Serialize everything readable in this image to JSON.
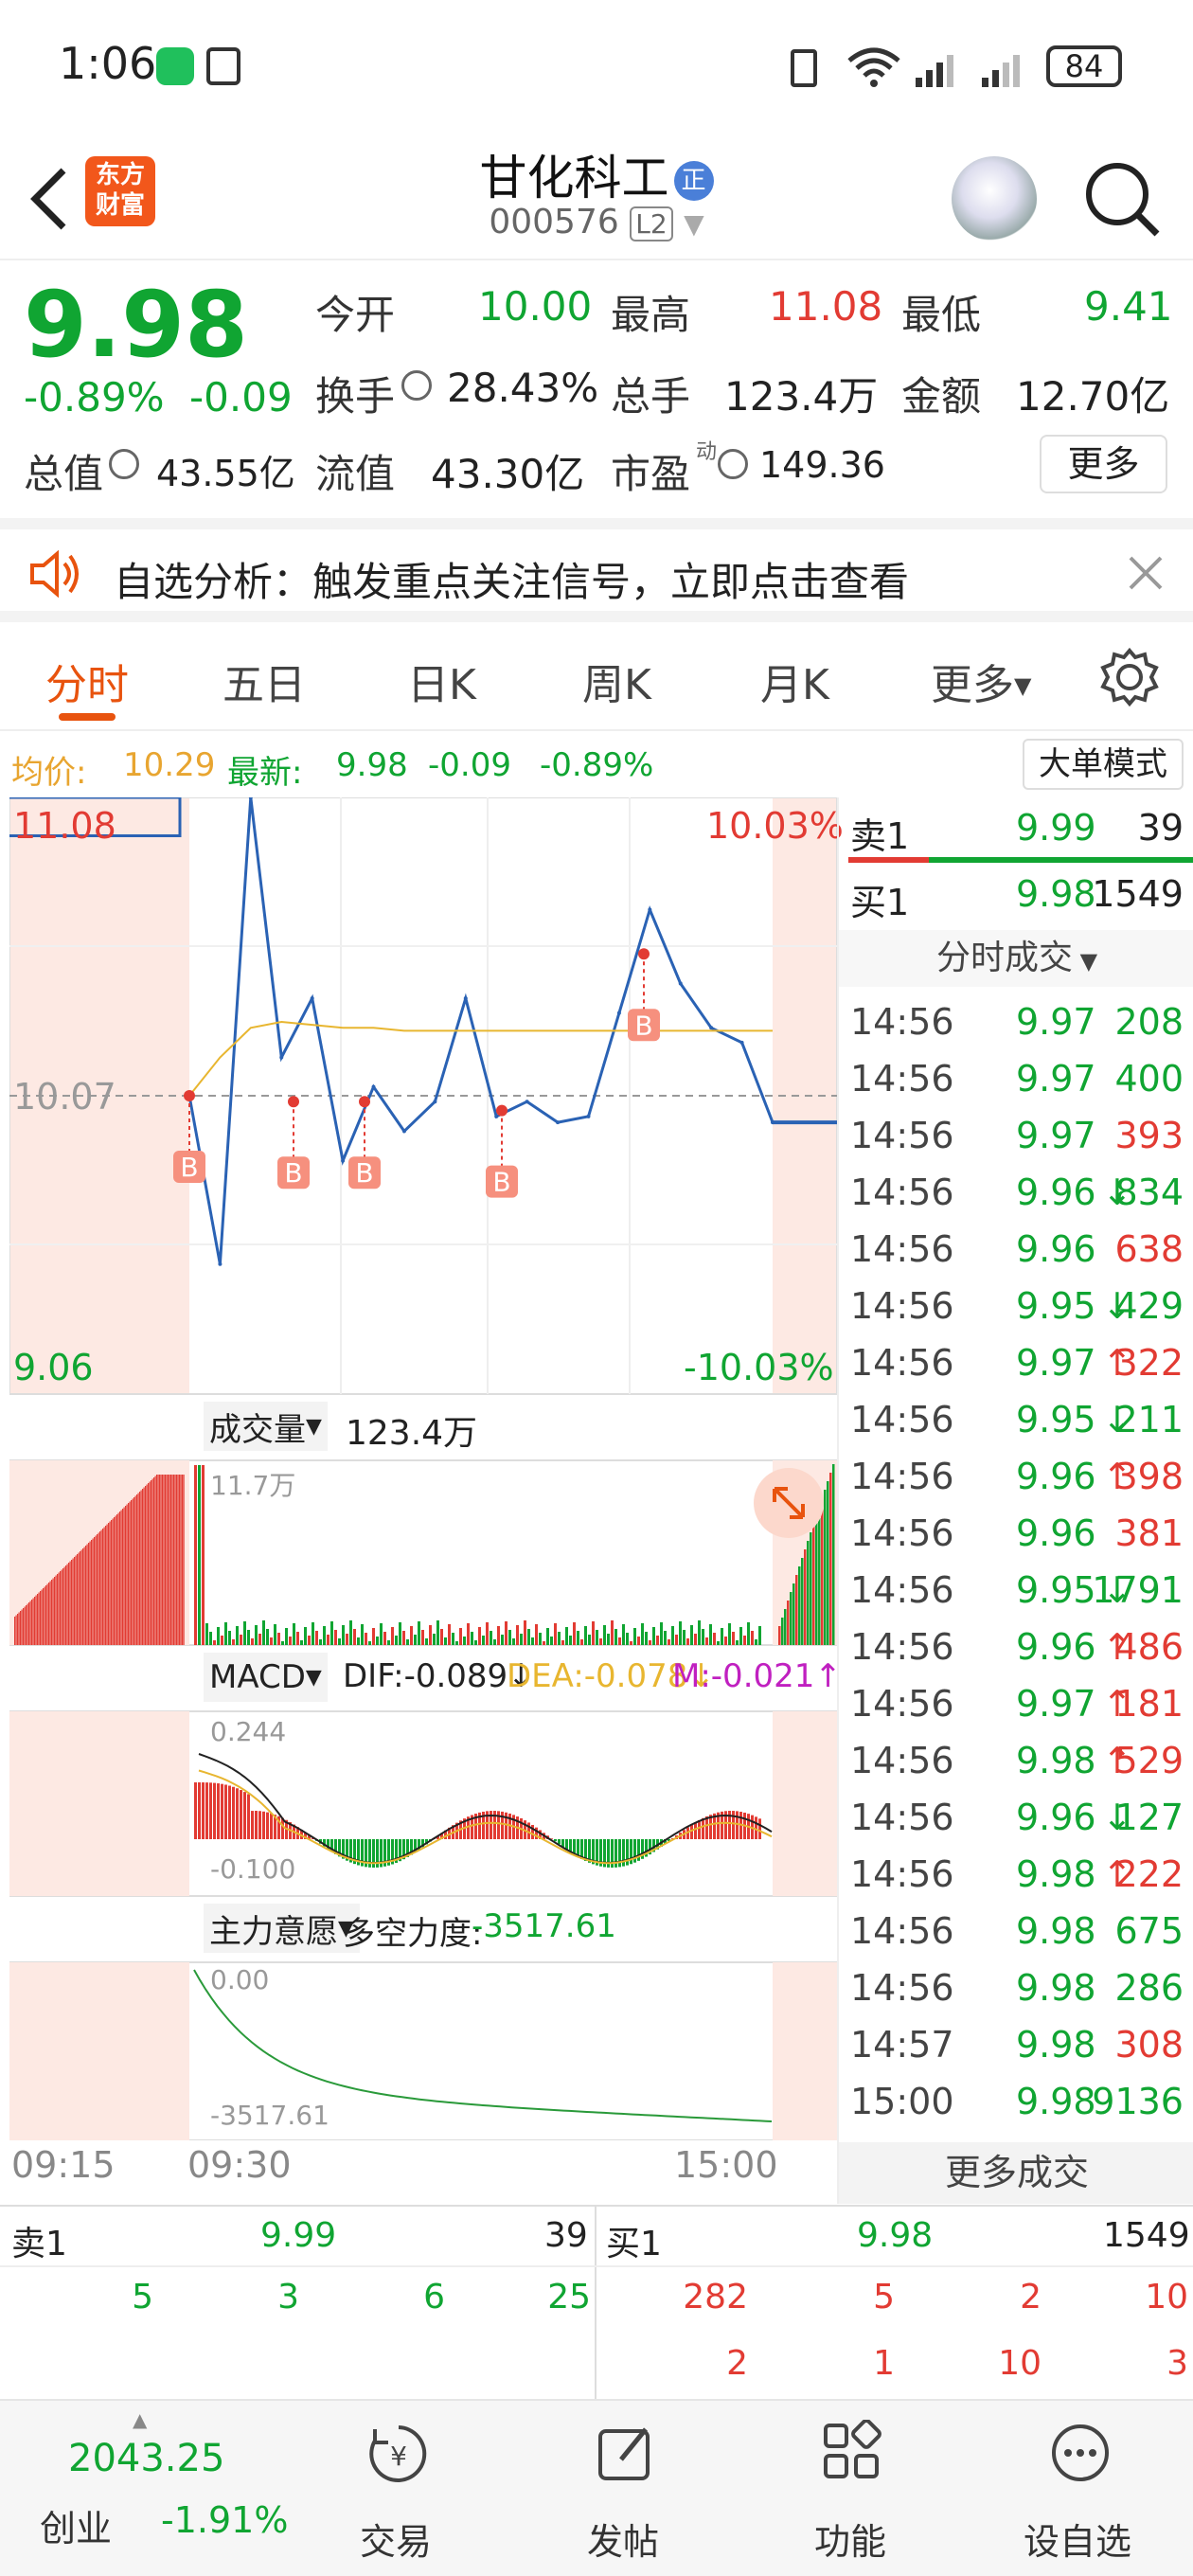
{
  "status_bar": {
    "time": "1:06",
    "battery": "84"
  },
  "header": {
    "logo_line1": "东方",
    "logo_line2": "财富",
    "stock_name": "甘化科工",
    "badge": "正",
    "stock_code": "000576",
    "level": "L2"
  },
  "quote": {
    "price": "9.98",
    "change_pct": "-0.89%",
    "change": "-0.09",
    "open_label": "今开",
    "open": "10.00",
    "high_label": "最高",
    "high": "11.08",
    "low_label": "最低",
    "low": "9.41",
    "turnover_label": "换手",
    "turnover": "28.43%",
    "volume_label": "总手",
    "volume": "123.4万",
    "amount_label": "金额",
    "amount": "12.70亿",
    "total_value_label": "总值",
    "total_value": "43.55亿",
    "float_value_label": "流值",
    "float_value": "43.30亿",
    "pe_label": "市盈",
    "pe_sup": "动",
    "pe": "149.36",
    "more_button": "更多"
  },
  "banner": {
    "text": "自选分析：触发重点关注信号，立即点击查看"
  },
  "tabs": [
    "分时",
    "五日",
    "日K",
    "周K",
    "月K",
    "更多"
  ],
  "avg_line": {
    "avg_label": "均价:",
    "avg": "10.29",
    "latest_label": "最新:",
    "latest": "9.98",
    "change": "-0.09",
    "change_pct": "-0.89%",
    "mode_button": "大单模式"
  },
  "chart": {
    "price_high": "11.08",
    "price_mid": "10.07",
    "price_low": "9.06",
    "pct_high": "10.03%",
    "pct_low": "-10.03%",
    "b_marker": "B",
    "volume_selector": "成交量",
    "volume_total": "123.4万",
    "volume_max": "11.7万",
    "macd_selector": "MACD",
    "dif": "DIF:-0.089↓",
    "dea": "DEA:-0.078↓",
    "m": "M:-0.021↑",
    "macd_high": "0.244",
    "macd_low": "-0.100",
    "force_selector": "主力意愿",
    "force_label": "多空力度:",
    "force_value": "-3517.61",
    "force_high": "0.00",
    "force_low": "-3517.61",
    "time_labels": [
      "09:15",
      "09:30",
      "15:00"
    ]
  },
  "chart_data": {
    "type": "line",
    "title": "",
    "series": [
      {
        "values": [
          10.07,
          9.5,
          11.08,
          10.2,
          10.4,
          9.85,
          10.1,
          9.95,
          10.05,
          10.4,
          10.0,
          10.05,
          9.98,
          10.0,
          10.35,
          10.7,
          10.45,
          10.3,
          10.25,
          9.98
        ]
      },
      {
        "values": [
          10.07,
          10.2,
          10.3,
          10.32,
          10.31,
          10.3,
          10.3,
          10.29,
          10.29,
          10.29,
          10.29,
          10.29,
          10.29,
          10.29,
          10.29,
          10.29,
          10.29,
          10.29,
          10.29,
          10.29
        ]
      }
    ],
    "ylim": [
      9.06,
      11.08
    ]
  },
  "order_book": {
    "sell1_label": "卖1",
    "sell1_price": "9.99",
    "sell1_vol": "39",
    "buy1_label": "买1",
    "buy1_price": "9.98",
    "buy1_vol": "1549",
    "trades_header": "分时成交",
    "trades": [
      {
        "t": "14:56",
        "p": "9.97",
        "v": "208",
        "arrow": "",
        "c": "green"
      },
      {
        "t": "14:56",
        "p": "9.97",
        "v": "400",
        "arrow": "",
        "c": "green"
      },
      {
        "t": "14:56",
        "p": "9.97",
        "v": "393",
        "arrow": "",
        "c": "red"
      },
      {
        "t": "14:56",
        "p": "9.96",
        "v": "834",
        "arrow": "↓",
        "c": "green"
      },
      {
        "t": "14:56",
        "p": "9.96",
        "v": "638",
        "arrow": "",
        "c": "red"
      },
      {
        "t": "14:56",
        "p": "9.95",
        "v": "429",
        "arrow": "↓",
        "c": "green"
      },
      {
        "t": "14:56",
        "p": "9.97",
        "v": "322",
        "arrow": "↑",
        "c": "red"
      },
      {
        "t": "14:56",
        "p": "9.95",
        "v": "211",
        "arrow": "↓",
        "c": "green"
      },
      {
        "t": "14:56",
        "p": "9.96",
        "v": "398",
        "arrow": "↑",
        "c": "red"
      },
      {
        "t": "14:56",
        "p": "9.96",
        "v": "381",
        "arrow": "",
        "c": "red"
      },
      {
        "t": "14:56",
        "p": "9.95",
        "v": "1791",
        "arrow": "↓",
        "c": "green"
      },
      {
        "t": "14:56",
        "p": "9.96",
        "v": "486",
        "arrow": "↑",
        "c": "red"
      },
      {
        "t": "14:56",
        "p": "9.97",
        "v": "181",
        "arrow": "↑",
        "c": "red"
      },
      {
        "t": "14:56",
        "p": "9.98",
        "v": "529",
        "arrow": "↑",
        "c": "red"
      },
      {
        "t": "14:56",
        "p": "9.96",
        "v": "127",
        "arrow": "↓",
        "c": "green"
      },
      {
        "t": "14:56",
        "p": "9.98",
        "v": "222",
        "arrow": "↑",
        "c": "red"
      },
      {
        "t": "14:56",
        "p": "9.98",
        "v": "675",
        "arrow": "",
        "c": "green"
      },
      {
        "t": "14:56",
        "p": "9.98",
        "v": "286",
        "arrow": "",
        "c": "green"
      },
      {
        "t": "14:57",
        "p": "9.98",
        "v": "308",
        "arrow": "",
        "c": "red"
      },
      {
        "t": "15:00",
        "p": "9.98",
        "v": "9136",
        "arrow": "",
        "c": "green"
      }
    ],
    "more_trades": "更多成交"
  },
  "bottom_book": {
    "sell_label": "卖1",
    "sell_price": "9.99",
    "sell_vol": "39",
    "buy_label": "买1",
    "buy_price": "9.98",
    "buy_vol": "1549",
    "sell_row": [
      "5",
      "3",
      "6",
      "25"
    ],
    "buy_row1": [
      "282",
      "5",
      "2",
      "10"
    ],
    "buy_row2": [
      "2",
      "1",
      "10",
      "3"
    ]
  },
  "nav": {
    "index_value": "2043.25",
    "index_name": "创业",
    "index_change": "-1.91%",
    "items": [
      "交易",
      "发帖",
      "功能",
      "设自选"
    ]
  },
  "colors": {
    "up": "#e23b33",
    "down": "#10a532",
    "accent": "#e8530e",
    "avg": "#e8b630",
    "line": "#2a62b4"
  }
}
